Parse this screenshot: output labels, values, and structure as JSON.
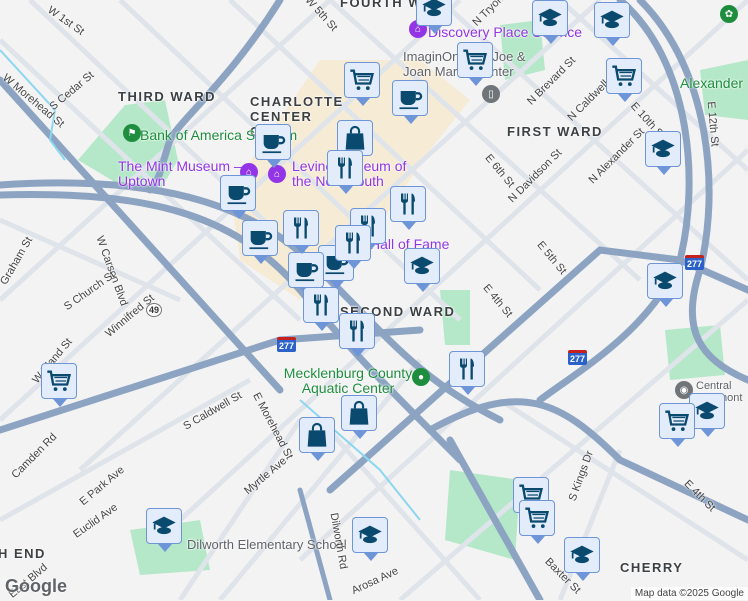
{
  "districts": [
    "THIRD WARD",
    "CHARLOTTE CENTER CITY",
    "FIRST WARD",
    "SECOND WARD",
    "FOURTH WARD",
    "CHERRY",
    "H END"
  ],
  "parks": [
    "Bank of America Stadium",
    "Mecklenburg County Aquatic Center",
    "Alexander"
  ],
  "pois": [
    "The Mint Museum – Uptown",
    "Levine Museum of the New South",
    "Discovery Place Science",
    "Hall of Fame"
  ],
  "places": [
    "ImaginOn: The Joe & Joan Martin Center",
    "Dilworth Elementary School",
    "Central Piedmont"
  ],
  "streets": [
    "W 1st St",
    "S Cedar St",
    "W Morehead St",
    "W 5th St",
    "N Tryon St",
    "N Brevard St",
    "N Caldwell St",
    "E 10th St",
    "E 12th St",
    "N Alexander St",
    "N Davidson St",
    "E 6th St",
    "E 5th St",
    "E 4th St",
    "W Carson Blvd",
    "S Church St",
    "Winnifred St",
    "W Bland St",
    "Camden Rd",
    "S Caldwell St",
    "E Morehead St",
    "Myrtle Ave",
    "Euclid Ave",
    "E Park Ave",
    "East Blvd",
    "Dilworth Rd",
    "Arosa Ave",
    "S Kings Dr",
    "Baxter St",
    "Graham St",
    "E 4th St"
  ],
  "highways": [
    "277",
    "277",
    "277",
    "49"
  ],
  "attribution": "Map data ©2025 Google",
  "logo": "Google",
  "colors": {
    "highway": "#8ca4c2",
    "park": "#a8e4be",
    "marker_fill": "#e3ecfb",
    "marker_border": "#6e95d8",
    "icon": "#0b4a6f",
    "poi": "#9334e6"
  }
}
